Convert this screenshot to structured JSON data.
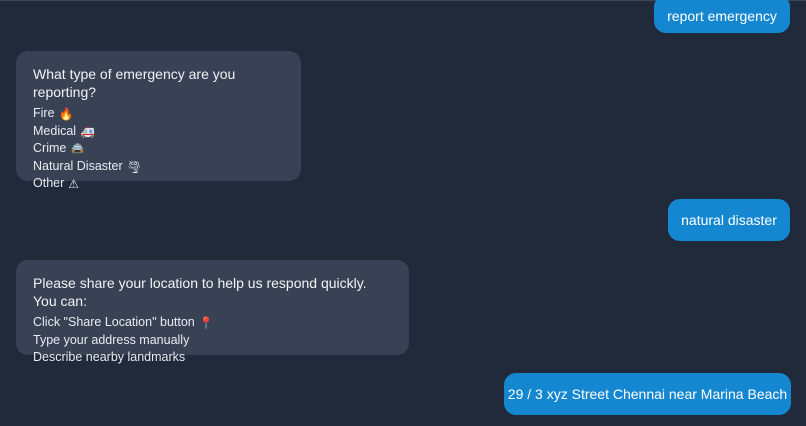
{
  "messages": {
    "user1": {
      "text": "report emergency"
    },
    "bot1": {
      "heading": "What type of emergency are you reporting?",
      "options": [
        {
          "label": "Fire",
          "icon": "fire-icon",
          "glyph": "🔥"
        },
        {
          "label": "Medical",
          "icon": "ambulance-icon",
          "glyph": "🚑"
        },
        {
          "label": "Crime",
          "icon": "police-car-icon",
          "glyph": "🚔"
        },
        {
          "label": "Natural Disaster",
          "icon": "tornado-icon",
          "glyph": "🌪"
        },
        {
          "label": "Other",
          "icon": "warning-icon",
          "glyph": "⚠"
        }
      ]
    },
    "user2": {
      "text": "natural disaster"
    },
    "bot2": {
      "heading": "Please share your location to help us respond quickly. You can:",
      "options": [
        {
          "label": "Click \"Share Location\" button",
          "icon": "pin-icon",
          "glyph": "📍"
        },
        {
          "label": "Type your address manually"
        },
        {
          "label": "Describe nearby landmarks"
        }
      ]
    },
    "user3": {
      "text": "29 / 3 xyz Street Chennai near Marina Beach"
    }
  },
  "colors": {
    "background": "#212a3a",
    "user_bubble": "#1487d0",
    "bot_bubble": "#384254"
  }
}
